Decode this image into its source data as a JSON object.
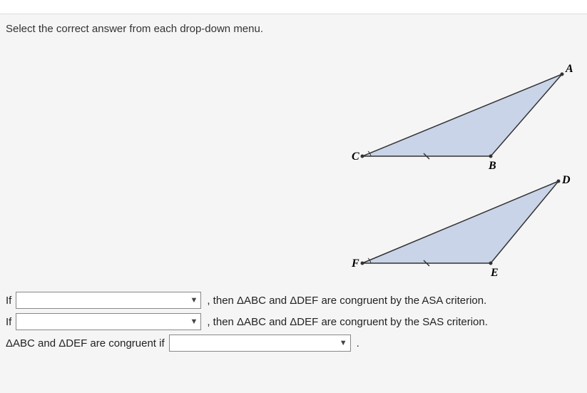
{
  "instruction": "Select the correct answer from each drop-down menu.",
  "triangles": {
    "t1": {
      "labelA": "A",
      "labelB": "B",
      "labelC": "C"
    },
    "t2": {
      "labelD": "D",
      "labelE": "E",
      "labelF": "F"
    }
  },
  "rows": {
    "row1": {
      "prefix": "If",
      "suffix": ", then ΔABC and ΔDEF are congruent by the ASA criterion."
    },
    "row2": {
      "prefix": "If",
      "suffix": ", then ΔABC and ΔDEF are congruent by the SAS criterion."
    },
    "row3": {
      "prefix": "ΔABC and ΔDEF are congruent if",
      "suffix": "."
    }
  }
}
